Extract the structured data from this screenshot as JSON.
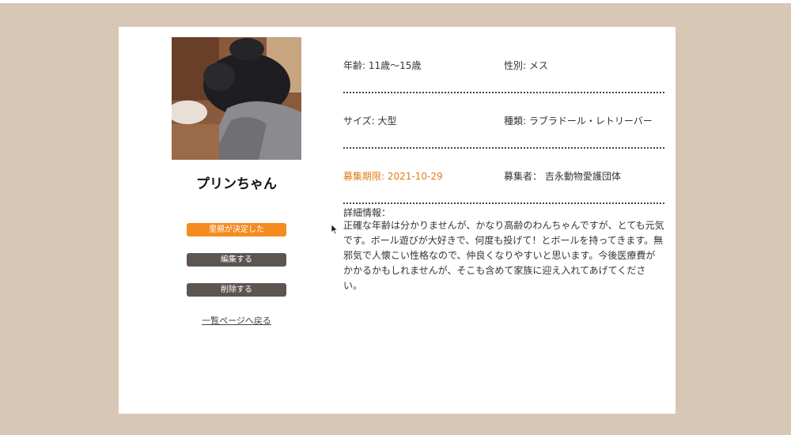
{
  "colors": {
    "page_background": "#d8c7b5",
    "card_background": "#ffffff",
    "adopted_button": "#f58a1f",
    "action_button": "#5d5552",
    "deadline_text": "#e07b12"
  },
  "pet": {
    "name": "プリンちゃん",
    "photo": "dog-photo"
  },
  "actions": {
    "adopted_label": "里親が決定した",
    "edit_label": "編集する",
    "delete_label": "削除する",
    "back_label": "一覧ページへ戻る"
  },
  "info": {
    "age": "年齢: 11歳〜15歳",
    "gender": "性別: メス",
    "size": "サイズ: 大型",
    "breed": "種類: ラブラドール・レトリーバー",
    "deadline": "募集期限: 2021-10-29",
    "recruiter": "募集者： 吉永動物愛護団体"
  },
  "details": {
    "title": "詳細情報：",
    "body": "正確な年齢は分かりませんが、かなり高齢のわんちゃんですが、とても元気です。ボール遊びが大好きで、何度も投げて！とボールを持ってきます。無邪気で人懐こい性格なので、仲良くなりやすいと思います。今後医療費がかかるかもしれませんが、そこも含めて家族に迎え入れてあげてください。"
  }
}
